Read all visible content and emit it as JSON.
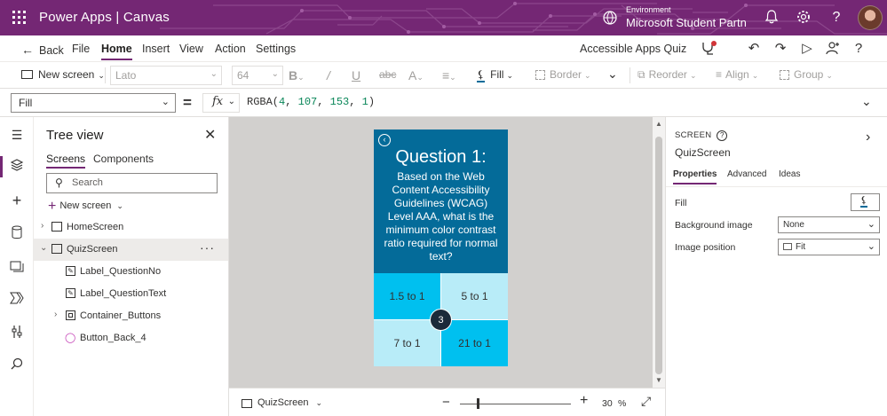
{
  "header": {
    "app_title": "Power Apps  |  Canvas",
    "environment_label": "Environment",
    "environment_name": "Microsoft Student Partn"
  },
  "command_bar": {
    "back": "Back",
    "menus": [
      "File",
      "Home",
      "Insert",
      "View",
      "Action",
      "Settings"
    ],
    "app_name": "Accessible Apps Quiz"
  },
  "format_bar": {
    "new_screen": "New screen",
    "font": "Lato",
    "font_size": "64",
    "fill": "Fill",
    "border": "Border",
    "reorder": "Reorder",
    "align": "Align",
    "group": "Group"
  },
  "formula_bar": {
    "property": "Fill",
    "fx": "fx",
    "formula_fn": "RGBA(",
    "formula_args": [
      "4",
      "107",
      "153",
      "1"
    ],
    "formula_close": ")"
  },
  "tree": {
    "title": "Tree view",
    "tabs": [
      "Screens",
      "Components"
    ],
    "search_placeholder": "Search",
    "new_screen": "New screen",
    "items": [
      "HomeScreen",
      "QuizScreen",
      "Label_QuestionNo",
      "Label_QuestionText",
      "Container_Buttons",
      "Button_Back_4"
    ]
  },
  "canvas": {
    "question_no": "Question 1:",
    "question_text": "Based on the Web Content Accessibility Guidelines (WCAG) Level AAA, what is the minimum color contrast ratio required for normal text?",
    "answers": [
      "1.5 to 1",
      "5 to 1",
      "7 to 1",
      "21 to 1"
    ],
    "badge": "3",
    "screen_name": "QuizScreen",
    "zoom": "30",
    "zoom_unit": "%"
  },
  "properties_panel": {
    "caption": "SCREEN",
    "name": "QuizScreen",
    "tabs": [
      "Properties",
      "Advanced",
      "Ideas"
    ],
    "fill_label": "Fill",
    "bg_image_label": "Background image",
    "bg_image_value": "None",
    "image_position_label": "Image position",
    "image_position_value": "Fit"
  },
  "colors": {
    "brand": "#742774",
    "question_bg": "#046b99",
    "answer_dark": "#00c0ef",
    "answer_light": "#b8ecf8"
  }
}
